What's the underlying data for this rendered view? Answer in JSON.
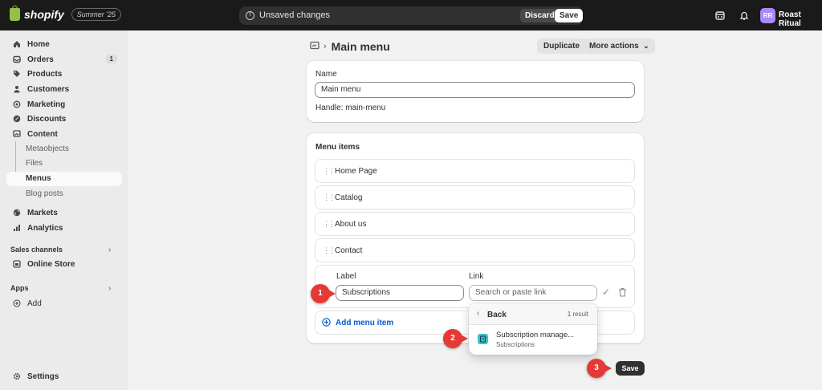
{
  "topbar": {
    "logo_text": "shopify",
    "logo_badge": "Summer '25",
    "unsaved_text": "Unsaved changes",
    "discard_label": "Discard",
    "save_label": "Save",
    "avatar_initials": "RR",
    "store_name": "Roast Ritual"
  },
  "sidebar": {
    "items": [
      {
        "label": "Home",
        "icon": "home-icon"
      },
      {
        "label": "Orders",
        "icon": "orders-icon",
        "badge": "1"
      },
      {
        "label": "Products",
        "icon": "tag-icon"
      },
      {
        "label": "Customers",
        "icon": "person-icon"
      },
      {
        "label": "Marketing",
        "icon": "target-icon"
      },
      {
        "label": "Discounts",
        "icon": "discount-icon"
      },
      {
        "label": "Content",
        "icon": "content-icon"
      }
    ],
    "content_sub": [
      "Metaobjects",
      "Files",
      "Menus",
      "Blog posts"
    ],
    "items2": [
      {
        "label": "Markets",
        "icon": "globe-icon"
      },
      {
        "label": "Analytics",
        "icon": "chart-icon"
      }
    ],
    "sales_channels_label": "Sales channels",
    "online_store_label": "Online Store",
    "apps_label": "Apps",
    "add_label": "Add",
    "settings_label": "Settings"
  },
  "page": {
    "title": "Main menu",
    "duplicate_label": "Duplicate",
    "more_actions_label": "More actions"
  },
  "name_card": {
    "label": "Name",
    "value": "Main menu",
    "handle": "Handle: main-menu"
  },
  "menu_items": {
    "heading": "Menu items",
    "items": [
      "Home Page",
      "Catalog",
      "About us",
      "Contact"
    ],
    "edit": {
      "label_heading": "Label",
      "link_heading": "Link",
      "label_value": "Subscriptions",
      "link_placeholder": "Search or paste link"
    },
    "add_label": "Add menu item"
  },
  "popover": {
    "back_label": "Back",
    "result_count": "1 result",
    "result_title": "Subscription manage...",
    "result_subtitle": "Subscriptions"
  },
  "steps": [
    "1",
    "2",
    "3"
  ],
  "footer": {
    "save_label": "Save"
  }
}
